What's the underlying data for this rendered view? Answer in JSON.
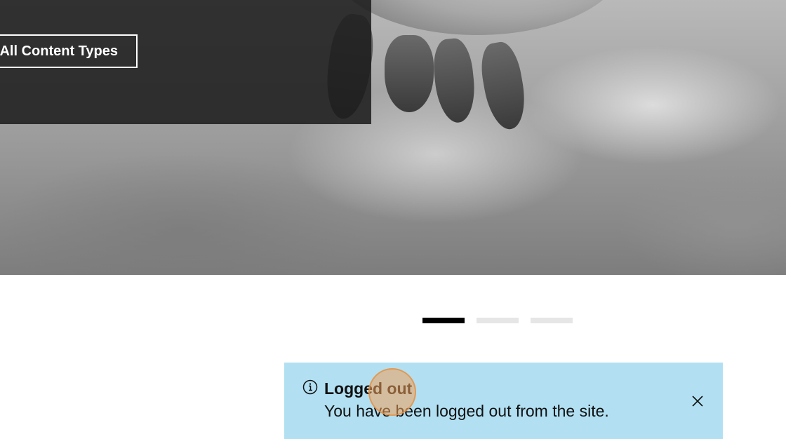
{
  "hero": {
    "cta_label": "All Content Types"
  },
  "pager": {
    "slides": 3,
    "active_index": 0
  },
  "notification": {
    "type": "info",
    "title": "Logged out",
    "message": "You have been logged out from the site.",
    "icon": "info-circle-icon",
    "close_icon": "close-icon",
    "background_color": "#b2e0f2"
  },
  "cursor": {
    "indicator_color": "#f0a05a"
  }
}
